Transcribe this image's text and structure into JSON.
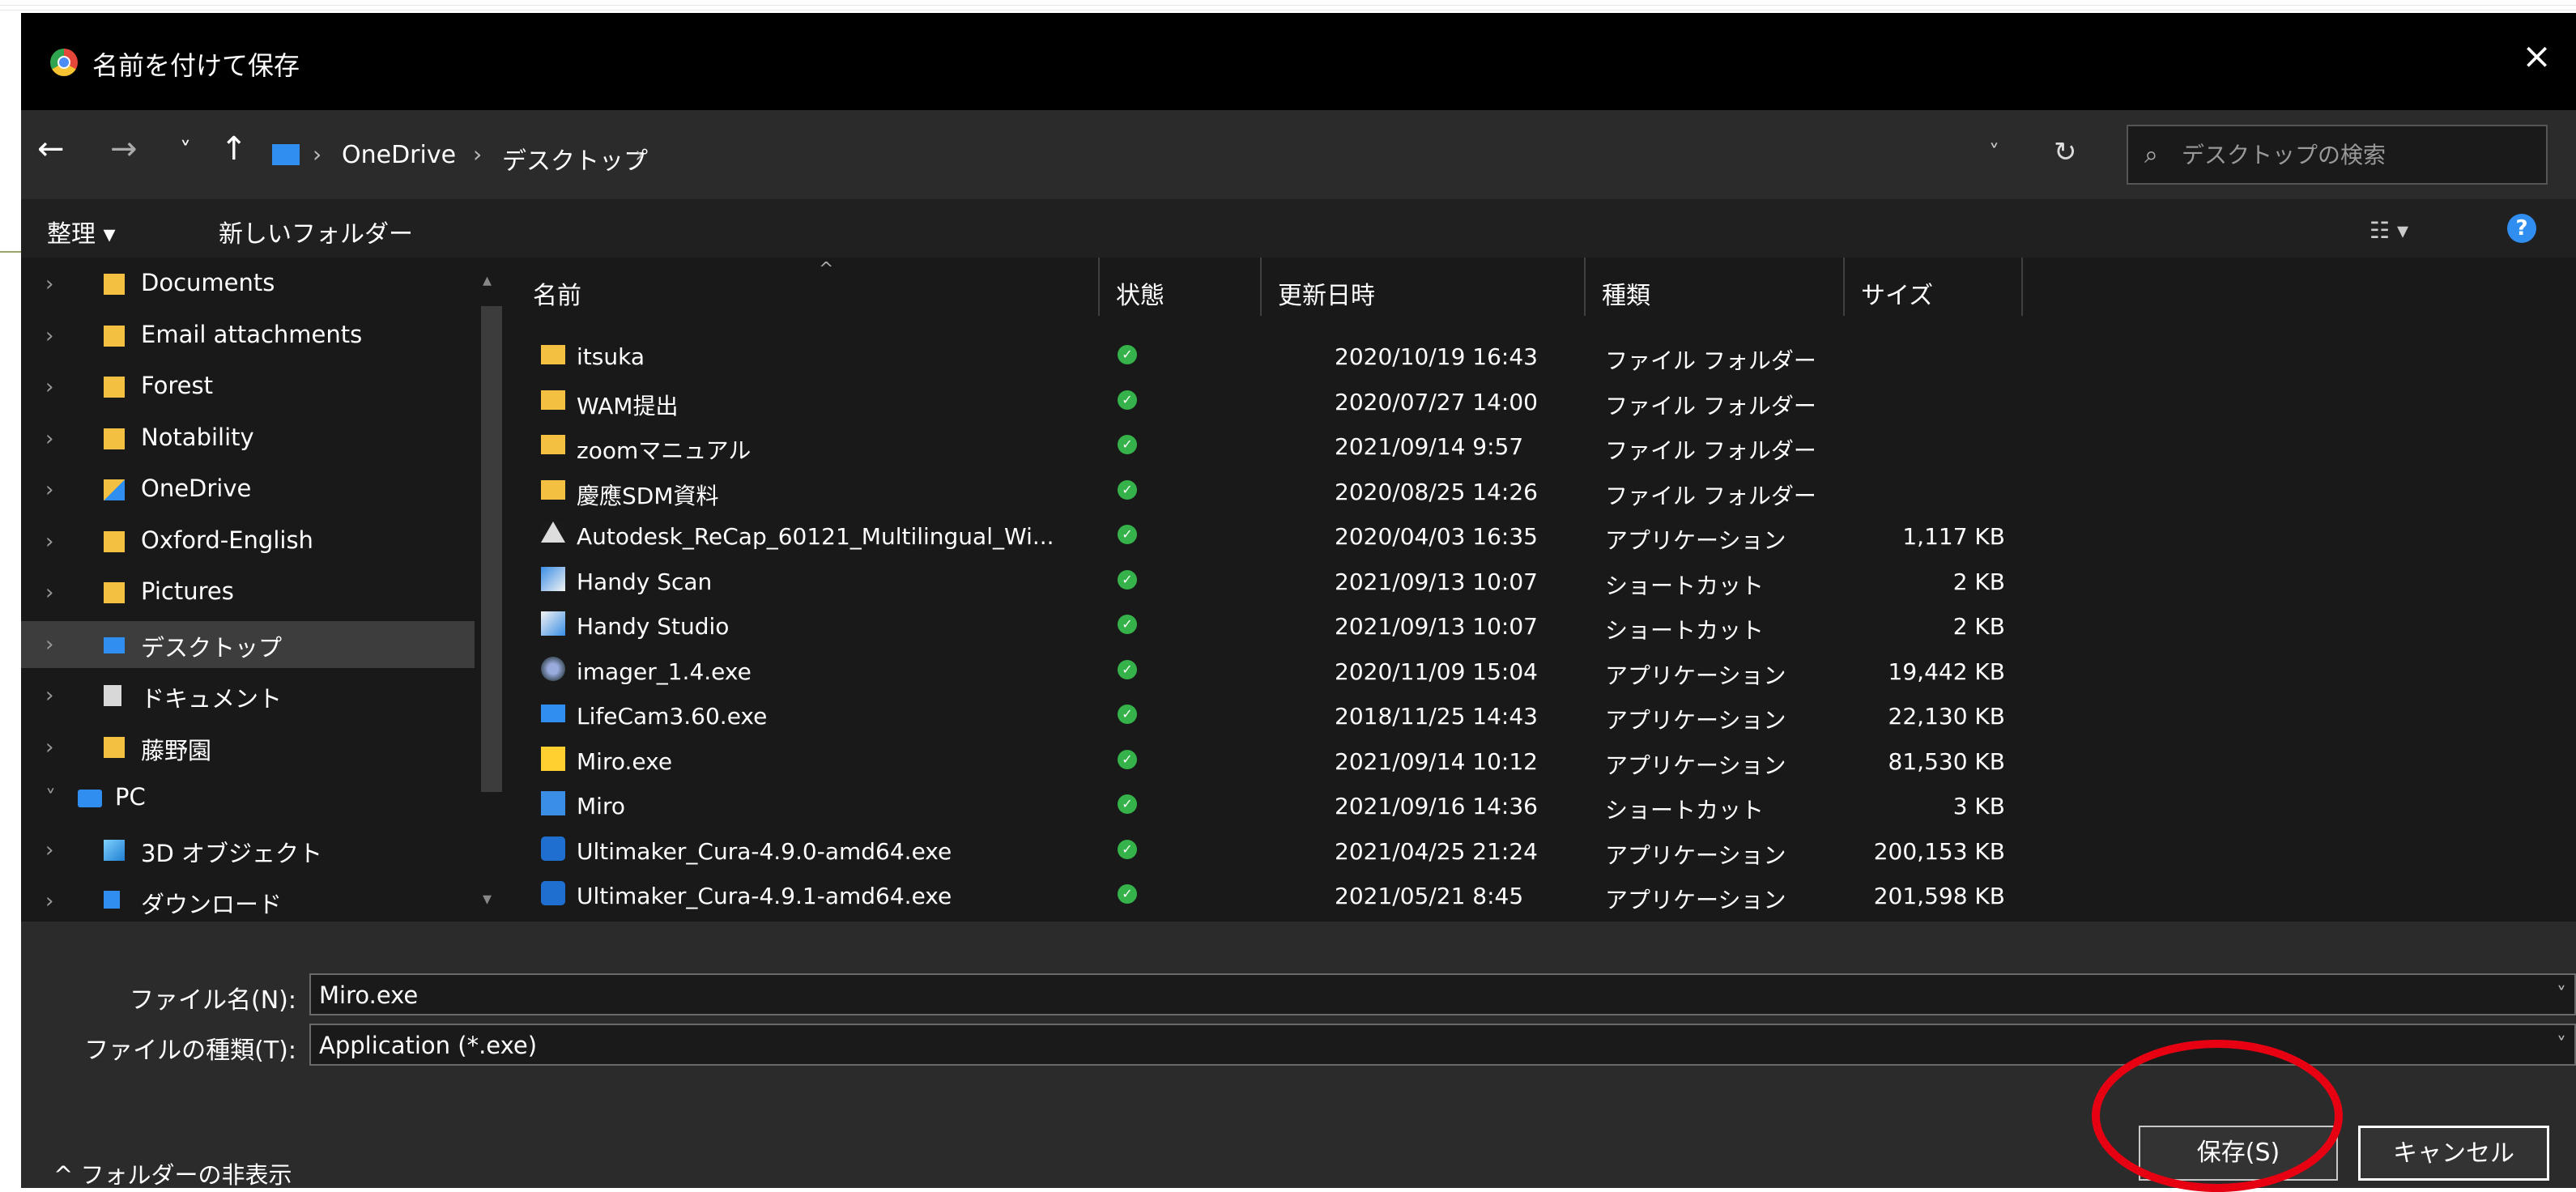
{
  "window": {
    "title": "名前を付けて保存",
    "close": "×"
  },
  "nav": {
    "back": "←",
    "forward": "→",
    "recent": "˅",
    "up": "↑",
    "breadcrumbs": [
      "OneDrive",
      "デスクトップ"
    ],
    "separator": "›",
    "dropdown": "˅",
    "refresh": "↻",
    "search_placeholder": "デスクトップの検索"
  },
  "toolbar": {
    "organize": "整理 ▾",
    "new_folder": "新しいフォルダー",
    "view": "☷ ▾",
    "help": "?"
  },
  "sidebar": {
    "items": [
      {
        "label": "Documents",
        "icon": "folder-icon",
        "chevron": "›"
      },
      {
        "label": "Email attachments",
        "icon": "folder-icon",
        "chevron": "›"
      },
      {
        "label": "Forest",
        "icon": "folder-icon",
        "chevron": "›"
      },
      {
        "label": "Notability",
        "icon": "folder-icon",
        "chevron": "›"
      },
      {
        "label": "OneDrive",
        "icon": "onedrive-folder-icon",
        "chevron": "›"
      },
      {
        "label": "Oxford-English",
        "icon": "folder-icon",
        "chevron": "›"
      },
      {
        "label": "Pictures",
        "icon": "folder-icon",
        "chevron": "›"
      },
      {
        "label": "デスクトップ",
        "icon": "desktop-folder-icon",
        "chevron": "›",
        "selected": true
      },
      {
        "label": "ドキュメント",
        "icon": "document-icon",
        "chevron": "›"
      },
      {
        "label": "藤野園",
        "icon": "folder-icon",
        "chevron": "›"
      },
      {
        "label": "PC",
        "icon": "pc-icon",
        "chevron": "˅"
      },
      {
        "label": "3D オブジェクト",
        "icon": "3d-objects-icon",
        "chevron": "›"
      },
      {
        "label": "ダウンロード",
        "icon": "download-icon",
        "chevron": "›"
      }
    ]
  },
  "columns": {
    "name": "名前",
    "status": "状態",
    "modified": "更新日時",
    "type": "種類",
    "size": "サイズ",
    "sort_indicator": "^"
  },
  "files": [
    {
      "name": "itsuka",
      "modified": "2020/10/19 16:43",
      "type": "ファイル フォルダー",
      "size": "",
      "icon": "folder"
    },
    {
      "name": "WAM提出",
      "modified": "2020/07/27 14:00",
      "type": "ファイル フォルダー",
      "size": "",
      "icon": "folder"
    },
    {
      "name": "zoomマニュアル",
      "modified": "2021/09/14 9:57",
      "type": "ファイル フォルダー",
      "size": "",
      "icon": "folder"
    },
    {
      "name": "慶應SDM資料",
      "modified": "2020/08/25 14:26",
      "type": "ファイル フォルダー",
      "size": "",
      "icon": "folder"
    },
    {
      "name": "Autodesk_ReCap_60121_Multilingual_Wi...",
      "modified": "2020/04/03 16:35",
      "type": "アプリケーション",
      "size": "1,117 KB",
      "icon": "autodesk"
    },
    {
      "name": "Handy Scan",
      "modified": "2021/09/13 10:07",
      "type": "ショートカット",
      "size": "2 KB",
      "icon": "handyscan"
    },
    {
      "name": "Handy Studio",
      "modified": "2021/09/13 10:07",
      "type": "ショートカット",
      "size": "2 KB",
      "icon": "handystudio"
    },
    {
      "name": "imager_1.4.exe",
      "modified": "2020/11/09 15:04",
      "type": "アプリケーション",
      "size": "19,442 KB",
      "icon": "imager"
    },
    {
      "name": "LifeCam3.60.exe",
      "modified": "2018/11/25 14:43",
      "type": "アプリケーション",
      "size": "22,130 KB",
      "icon": "lifecam"
    },
    {
      "name": "Miro.exe",
      "modified": "2021/09/14 10:12",
      "type": "アプリケーション",
      "size": "81,530 KB",
      "icon": "miro"
    },
    {
      "name": "Miro",
      "modified": "2021/09/16 14:36",
      "type": "ショートカット",
      "size": "3 KB",
      "icon": "mirolnk"
    },
    {
      "name": "Ultimaker_Cura-4.9.0-amd64.exe",
      "modified": "2021/04/25 21:24",
      "type": "アプリケーション",
      "size": "200,153 KB",
      "icon": "cura"
    },
    {
      "name": "Ultimaker_Cura-4.9.1-amd64.exe",
      "modified": "2021/05/21 8:45",
      "type": "アプリケーション",
      "size": "201,598 KB",
      "icon": "cura"
    }
  ],
  "status_check": "✓",
  "bottom": {
    "filename_label": "ファイル名(N):",
    "filename_value": "Miro.exe",
    "filetype_label": "ファイルの種類(T):",
    "filetype_value": "Application (*.exe)",
    "dropdown": "˅",
    "hide_folders": "^ フォルダーの非表示",
    "save": "保存(S)",
    "cancel": "キャンセル"
  },
  "colors": {
    "window_bg": "#191919",
    "titlebar": "#000000",
    "accent": "#2f8ef0",
    "status_green": "#35b34a",
    "annotation_red": "#e60012"
  }
}
